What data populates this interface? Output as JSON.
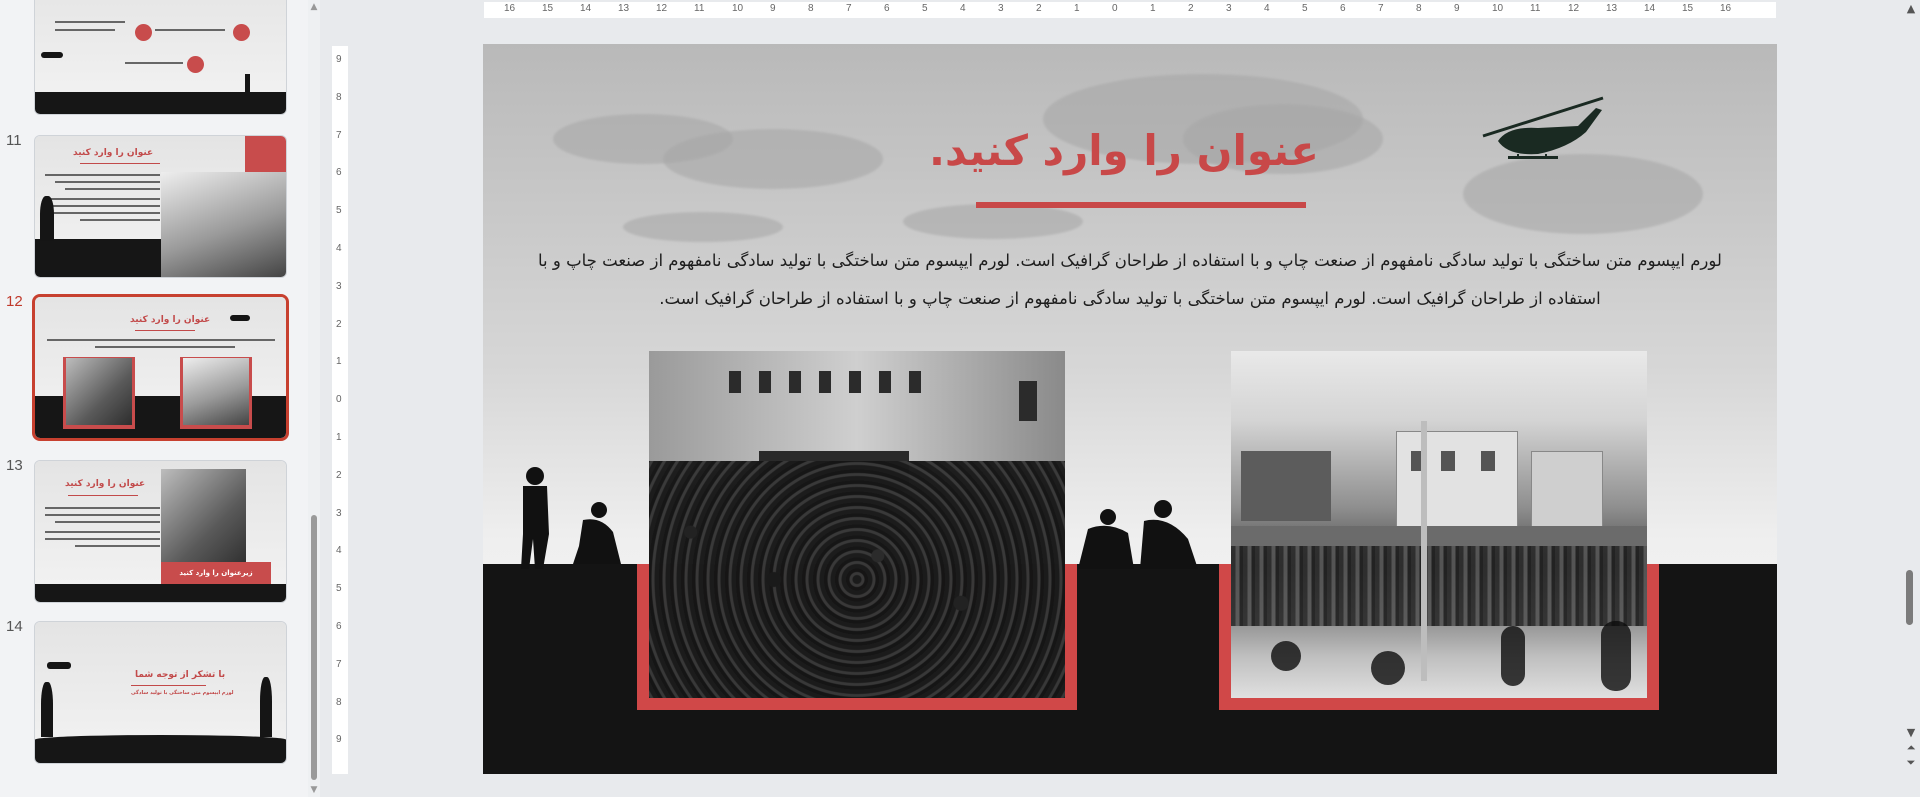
{
  "slide_panel": {
    "slides": [
      {
        "number": "11",
        "title": "عنوان را وارد کنید"
      },
      {
        "number": "12",
        "title": "عنوان را وارد کنید",
        "selected": true
      },
      {
        "number": "13",
        "title": "عنوان را وارد کنید",
        "button_label": "زیرعنوان را وارد کنید"
      },
      {
        "number": "14",
        "title": "با تشکر از توجه شما",
        "subtitle": "لورم ایپسوم متن ساختگی با تولید سادگی"
      }
    ]
  },
  "h_ruler": {
    "ticks": [
      "16",
      "15",
      "14",
      "13",
      "12",
      "11",
      "10",
      "9",
      "8",
      "7",
      "6",
      "5",
      "4",
      "3",
      "2",
      "1",
      "0",
      "1",
      "2",
      "3",
      "4",
      "5",
      "6",
      "7",
      "8",
      "9",
      "10",
      "11",
      "12",
      "13",
      "14",
      "15",
      "16"
    ]
  },
  "v_ruler": {
    "ticks": [
      "9",
      "8",
      "7",
      "6",
      "5",
      "4",
      "3",
      "2",
      "1",
      "0",
      "1",
      "2",
      "3",
      "4",
      "5",
      "6",
      "7",
      "8",
      "9"
    ]
  },
  "slide": {
    "title": "عنوان را وارد کنید.",
    "body": "لورم ایپسوم متن ساختگی با تولید سادگی نامفهوم از صنعت چاپ و با استفاده از طراحان گرافیک است. لورم ایپسوم متن ساختگی با تولید سادگی نامفهوم از صنعت چاپ و با استفاده از طراحان گرافیک است. لورم ایپسوم متن ساختگی با تولید سادگی نامفهوم از صنعت چاپ و با استفاده از طراحان گرافیک است.",
    "accent_color": "#c84848",
    "ground_color": "#141414"
  },
  "icons": {
    "helicopter": "helicopter-icon",
    "soldier": "soldier-silhouette-icon",
    "scroll_up": "chevron-up-icon",
    "scroll_down": "chevron-down-icon",
    "prev_page": "double-chevron-up-icon",
    "next_page": "double-chevron-down-icon"
  }
}
